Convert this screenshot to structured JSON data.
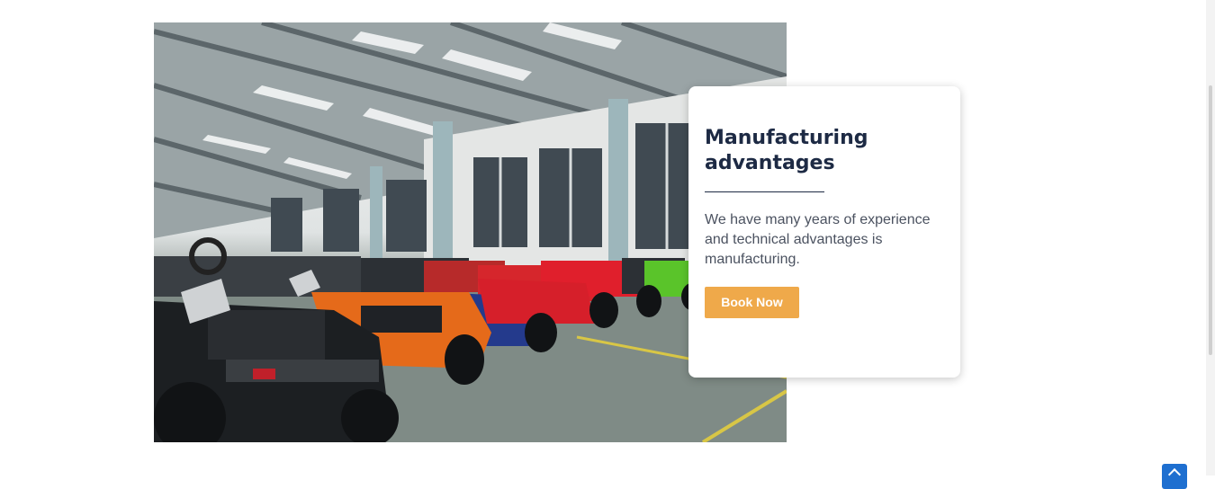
{
  "feature": {
    "title": "Manufacturing advantages",
    "description": "We have many years of experience and technical advantages is manufacturing.",
    "button_label": "Book Now"
  },
  "colors": {
    "title": "#1d2a44",
    "button": "#efa94a",
    "back_to_top": "#1e6fd0"
  },
  "icons": {
    "back_to_top": "chevron-up-icon"
  }
}
